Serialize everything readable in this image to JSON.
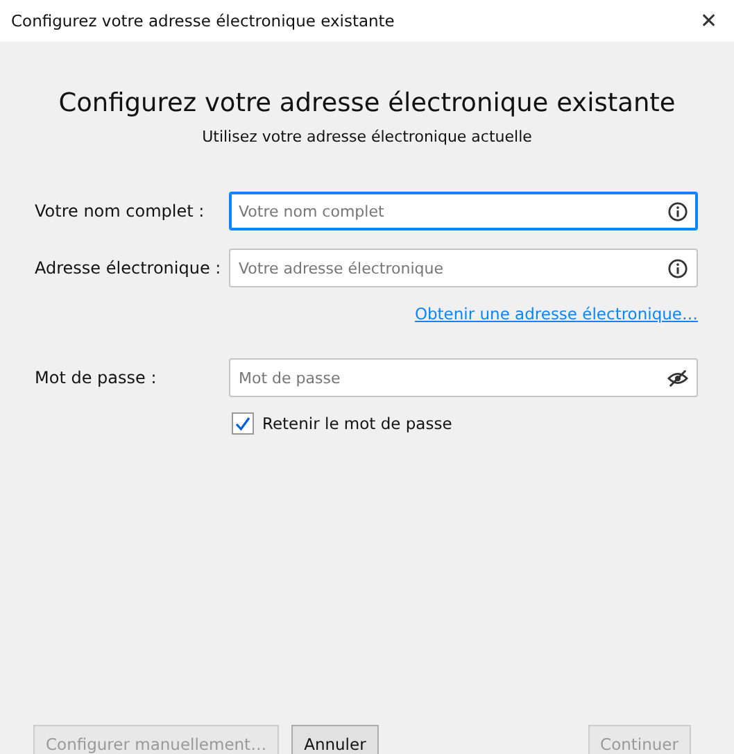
{
  "window": {
    "title": "Configurez votre adresse électronique existante",
    "close": "✕"
  },
  "heading": "Configurez votre adresse électronique existante",
  "subheading": "Utilisez votre adresse électronique actuelle",
  "fields": [
    {
      "label": "Votre nom complet :",
      "placeholder": "Votre nom complet",
      "kind": "info",
      "focused": true
    },
    {
      "label": "Adresse électronique :",
      "placeholder": "Votre adresse électronique",
      "kind": "info",
      "focused": false
    }
  ],
  "link": "Obtenir une adresse électronique…",
  "password": {
    "label": "Mot de passe :",
    "placeholder": "Mot de passe",
    "kind": "eye",
    "focused": false
  },
  "remember": {
    "label": "Retenir le mot de passe",
    "checked": true
  },
  "buttons": [
    {
      "label": "Configurer manuellement…",
      "disabled": true
    },
    {
      "label": "Annuler",
      "disabled": false
    }
  ],
  "continue": {
    "label": "Continuer",
    "disabled": true
  }
}
